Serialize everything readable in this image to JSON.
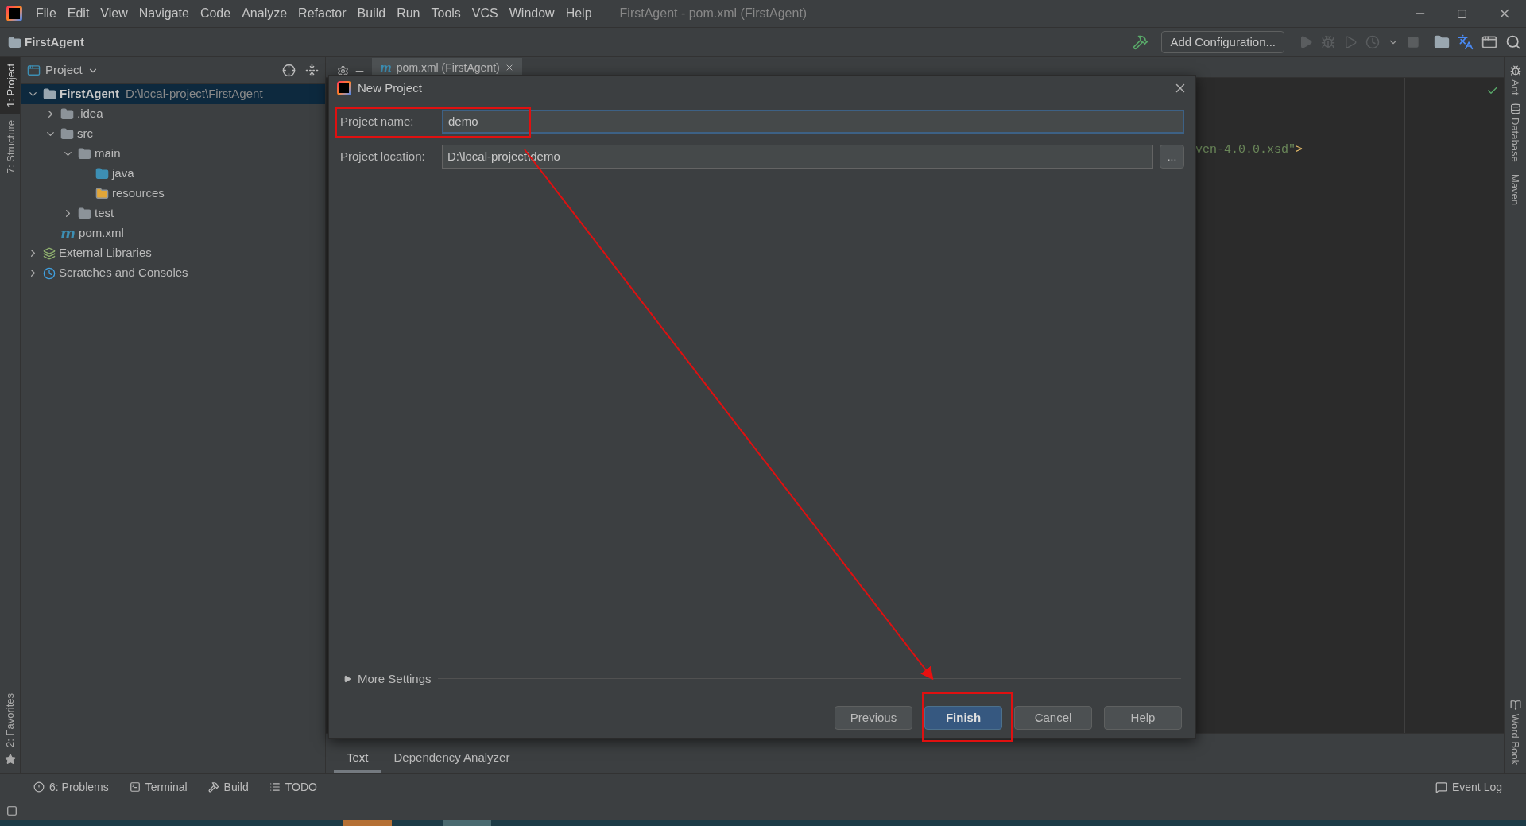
{
  "menu_bar": {
    "items": [
      "File",
      "Edit",
      "View",
      "Navigate",
      "Code",
      "Analyze",
      "Refactor",
      "Build",
      "Run",
      "Tools",
      "VCS",
      "Window",
      "Help"
    ],
    "title": "FirstAgent - pom.xml (FirstAgent)"
  },
  "nav_bar": {
    "project": "FirstAgent",
    "run_config": "Add Configuration..."
  },
  "left_strip": [
    {
      "label": "1: Project",
      "selected": true
    },
    {
      "label": "7: Structure",
      "selected": false
    }
  ],
  "left_strip_bottom": [
    {
      "label": "2: Favorites",
      "selected": false
    }
  ],
  "right_strip": [
    {
      "label": "Ant"
    },
    {
      "label": "Database"
    },
    {
      "label": "Maven"
    }
  ],
  "right_strip_bottom": [
    {
      "label": "Word Book"
    }
  ],
  "project_panel": {
    "title": "Project",
    "tree": [
      {
        "name": "FirstAgent",
        "path": "D:\\local-project\\FirstAgent",
        "kind": "module",
        "selected": true,
        "expanded": true,
        "children": [
          {
            "name": ".idea",
            "kind": "folder",
            "selected": false,
            "expanded": false
          },
          {
            "name": "src",
            "kind": "folder",
            "selected": false,
            "expanded": true,
            "children": [
              {
                "name": "main",
                "kind": "folder",
                "selected": false,
                "expanded": true,
                "children": [
                  {
                    "name": "java",
                    "kind": "source",
                    "selected": false
                  },
                  {
                    "name": "resources",
                    "kind": "resources",
                    "selected": false
                  }
                ]
              },
              {
                "name": "test",
                "kind": "folder",
                "selected": false,
                "expanded": false
              }
            ]
          },
          {
            "name": "pom.xml",
            "kind": "maven",
            "icon": "m",
            "selected": false
          }
        ]
      },
      {
        "name": "External Libraries",
        "kind": "libraries",
        "selected": false,
        "expanded": false
      },
      {
        "name": "Scratches and Consoles",
        "kind": "scratches",
        "selected": false,
        "expanded": false
      }
    ]
  },
  "editor": {
    "tab": {
      "icon": "m",
      "label": "pom.xml (FirstAgent)"
    },
    "code": [
      {
        "text": "ven-4.0.0.xsd\"",
        "kind": "string"
      },
      {
        "text": ">",
        "kind": "tag"
      }
    ],
    "bottom_tabs": [
      {
        "label": "Text",
        "selected": true
      },
      {
        "label": "Dependency Analyzer",
        "selected": false
      }
    ]
  },
  "dialog": {
    "title": "New Project",
    "fields": [
      {
        "label": "Project name:",
        "value": "demo",
        "focused": true
      },
      {
        "label": "Project location:",
        "value": "D:\\local-project\\demo",
        "focused": false,
        "browse": "..."
      }
    ],
    "more_settings": {
      "label": "More Settings",
      "expanded": false
    },
    "buttons": [
      {
        "label": "Previous",
        "default": false
      },
      {
        "label": "Finish",
        "default": true
      },
      {
        "label": "Cancel",
        "default": false
      },
      {
        "label": "Help",
        "default": false
      }
    ]
  },
  "tool_bar": [
    {
      "label": "6: Problems",
      "kind": "problems"
    },
    {
      "label": "Terminal",
      "kind": "terminal"
    },
    {
      "label": "Build",
      "kind": "build"
    },
    {
      "label": "TODO",
      "kind": "todo"
    }
  ],
  "event_log": "Event Log"
}
